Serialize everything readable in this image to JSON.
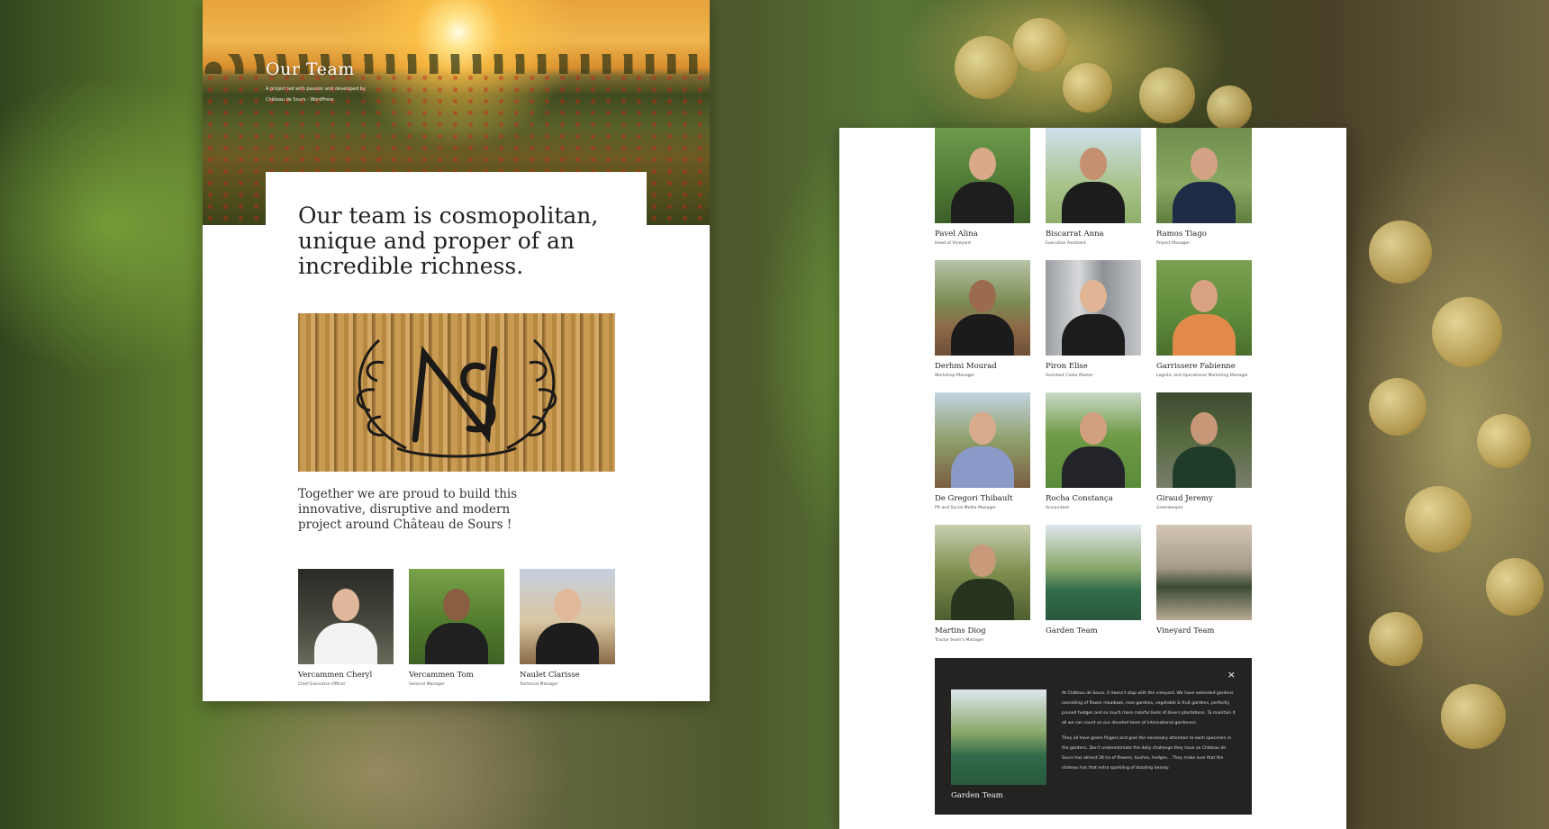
{
  "left_page": {
    "hero": {
      "title": "Our Team",
      "subtitle": "A project led with passion and developed by",
      "credit": "Château de Sours - WordPress"
    },
    "headline": "Our team is cosmopolitan, unique and proper of an incredible richness.",
    "tagline": "Together we are proud to build this innovative, disruptive and modern project around Château de Sours !",
    "leaders": [
      {
        "name": "Vercammen Cheryl",
        "role": "Chief Executive Officer"
      },
      {
        "name": "Vercammen Tom",
        "role": "General Manager"
      },
      {
        "name": "Naulet Clarisse",
        "role": "Technical Manager"
      }
    ]
  },
  "right_page": {
    "team": [
      {
        "name": "Pavel Alina",
        "role": "Head of Vineyard"
      },
      {
        "name": "Biscarrat Anna",
        "role": "Executive Assistant"
      },
      {
        "name": "Ramos Tiago",
        "role": "Project Manager"
      },
      {
        "name": "Derhmi Mourad",
        "role": "Workshop Manager"
      },
      {
        "name": "Piron Elise",
        "role": "Assistant Cellar Master"
      },
      {
        "name": "Garrissere Fabienne",
        "role": "Logistic and Operational Marketing Manager"
      },
      {
        "name": "De Gregori Thibault",
        "role": "PR and Social Media Manager"
      },
      {
        "name": "Rocha Constança",
        "role": "Accountant"
      },
      {
        "name": "Giraud Jeremy",
        "role": "Greenkeeper"
      },
      {
        "name": "Martins Diog",
        "role": "Tractor team's Manager"
      },
      {
        "name": "Garden Team",
        "role": ""
      },
      {
        "name": "Vineyard Team",
        "role": ""
      }
    ],
    "popup": {
      "close_label": "×",
      "name": "Garden Team",
      "paragraph_1": "At Château de Sours, it doesn't stop with the vineyard. We have extended gardens consisting of flower meadows, rose gardens, vegetable & fruit gardens, perfectly pruned hedges and so much more colorful beds of divers plantations. To maintain it all we can count on our devoted team of international gardeners.",
      "paragraph_2": "They all have green fingers and give the necessary attention to each specimen in the gardens. Don't underestimate the daily challenge they have as Château de Sours has almost 28 ha of flowers, bushes, hedges... They make sure that the chateau has that extra sparkling of dazzling beauty."
    }
  },
  "colors": {
    "page_bg": "#ffffff",
    "popup_bg": "#252222",
    "text_dark": "#222222"
  },
  "icons": [
    "close-icon",
    "sours-monogram-logo"
  ]
}
